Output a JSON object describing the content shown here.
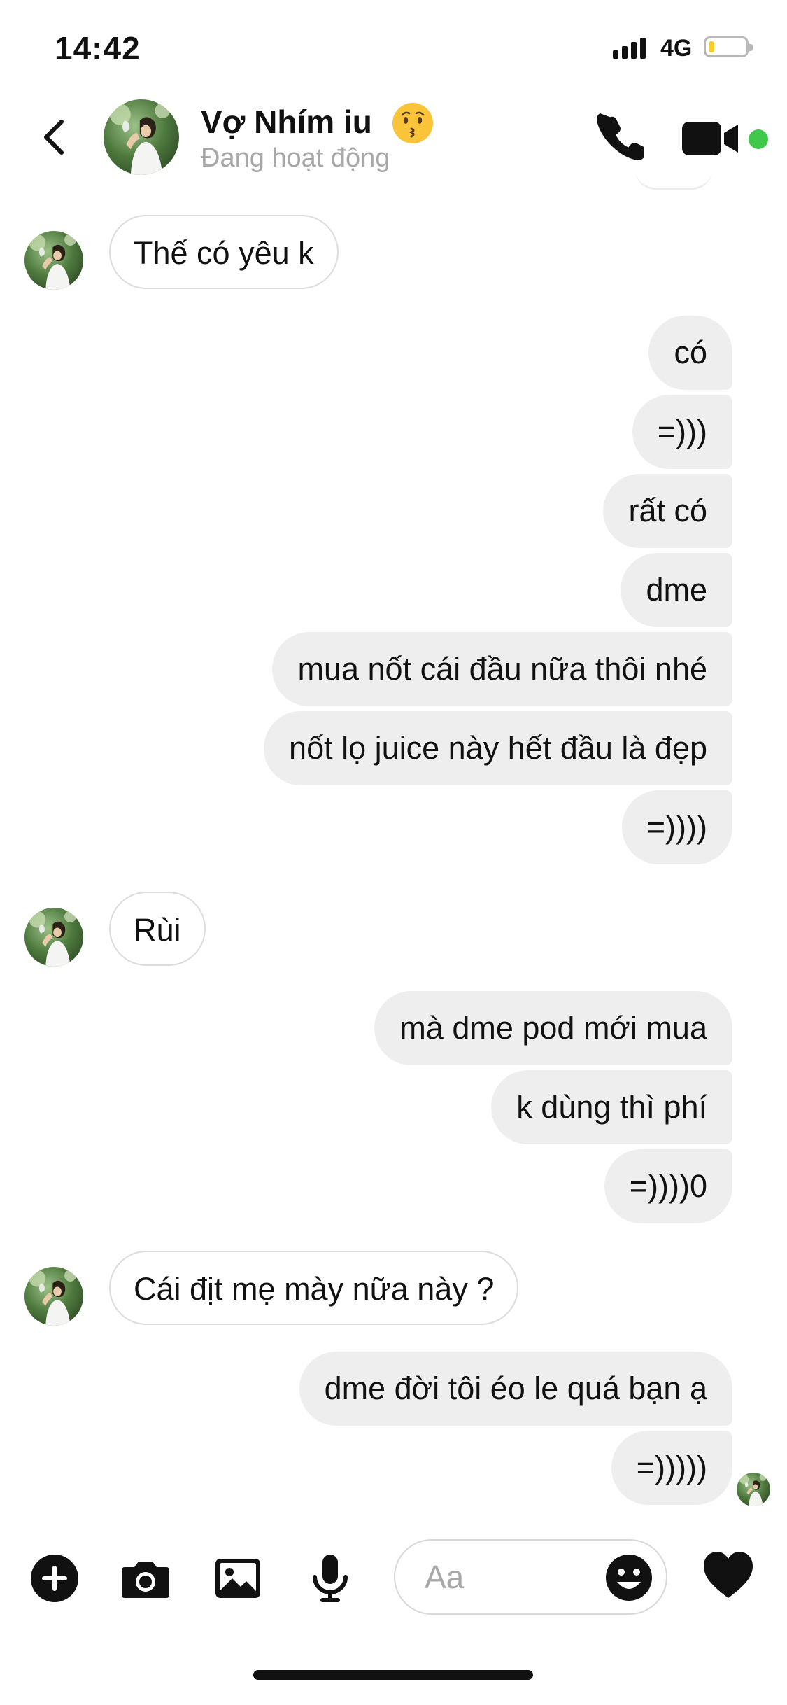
{
  "status_bar": {
    "time": "14:42",
    "network": "4G",
    "battery_level": 0.15
  },
  "header": {
    "contact_name": "Vợ Nhím iu",
    "name_emoji": "kissing-face-emoji",
    "status": "Đang hoạt động",
    "online_color": "#3fc84a"
  },
  "messages": [
    {
      "side": "in",
      "text": "Thế có yêu k"
    },
    {
      "side": "out",
      "text": "có"
    },
    {
      "side": "out",
      "text": "=)))"
    },
    {
      "side": "out",
      "text": "rất có"
    },
    {
      "side": "out",
      "text": "dme"
    },
    {
      "side": "out",
      "text": "mua nốt cái đầu nữa thôi nhé"
    },
    {
      "side": "out",
      "text": "nốt lọ juice này hết đầu là đẹp"
    },
    {
      "side": "out",
      "text": "=))))"
    },
    {
      "side": "in",
      "text": "Rùi"
    },
    {
      "side": "out",
      "text": "mà dme pod mới mua"
    },
    {
      "side": "out",
      "text": "k dùng thì phí"
    },
    {
      "side": "out",
      "text": "=))))0"
    },
    {
      "side": "in",
      "text": "Cái địt mẹ mày nữa này ?"
    },
    {
      "side": "out",
      "text": "dme đời tôi éo le quá bạn ạ"
    },
    {
      "side": "out",
      "text": "=)))))"
    }
  ],
  "composer": {
    "placeholder": "Aa",
    "value": "",
    "icons": [
      "plus-icon",
      "camera-icon",
      "gallery-icon",
      "microphone-icon",
      "emoji-icon",
      "heart-icon"
    ]
  },
  "colors": {
    "outgoing_bubble": "#eeeeee",
    "incoming_border": "#dcdcdc",
    "status_gray": "#a7a7a7"
  }
}
